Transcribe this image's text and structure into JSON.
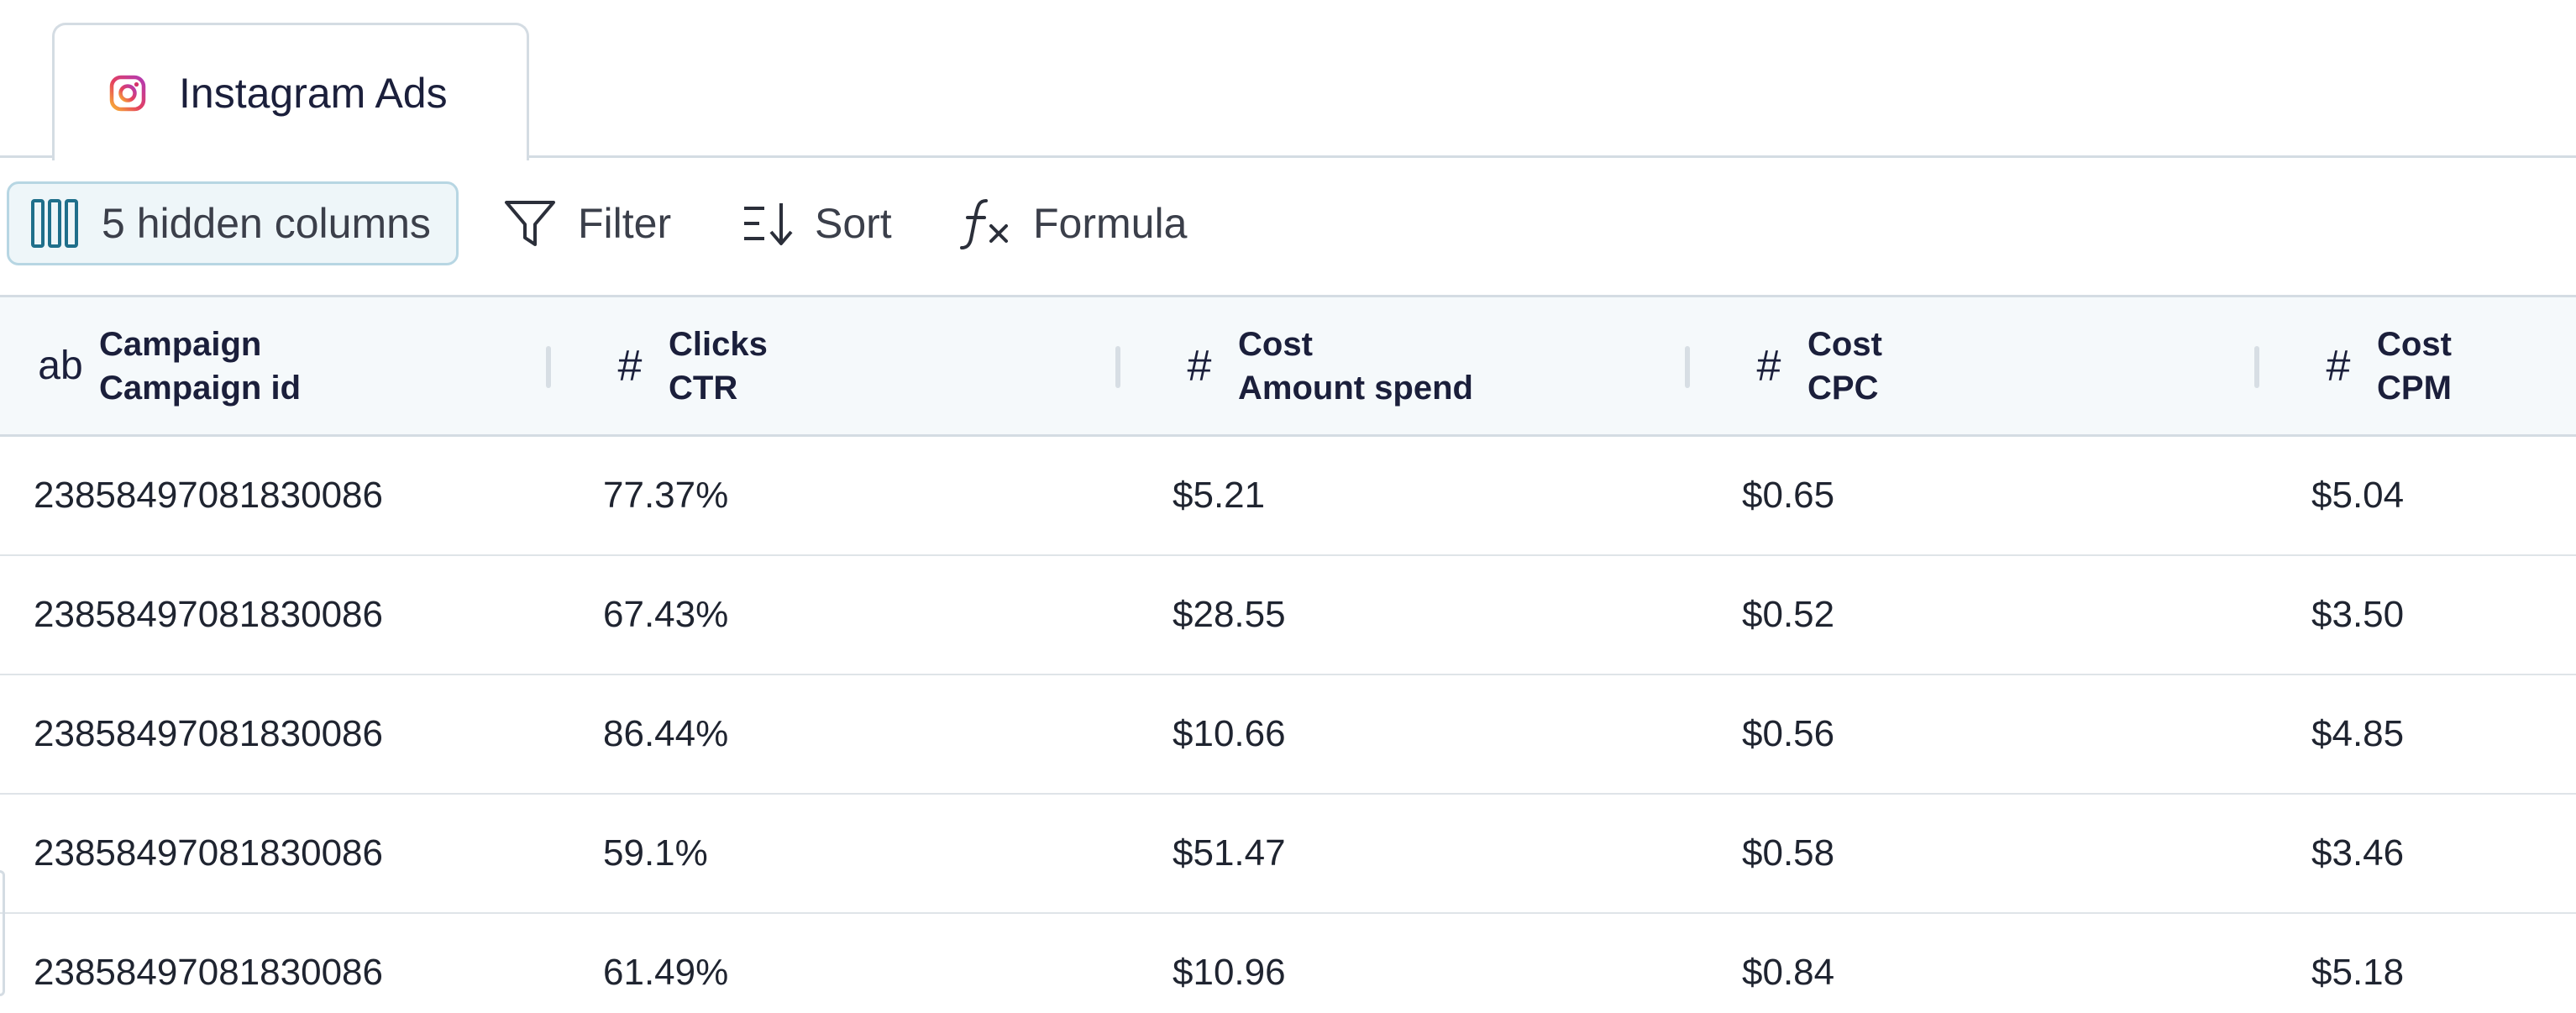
{
  "tab": {
    "icon": "instagram-icon",
    "label": "Instagram Ads"
  },
  "toolbar": {
    "hidden_columns": {
      "icon": "columns-icon",
      "label": "5 hidden columns"
    },
    "filter": {
      "icon": "filter-icon",
      "label": "Filter"
    },
    "sort": {
      "icon": "sort-icon",
      "label": "Sort"
    },
    "formula": {
      "icon": "formula-icon",
      "label": "Formula"
    }
  },
  "table": {
    "columns": [
      {
        "type": "ab",
        "line1": "Campaign",
        "line2": "Campaign id"
      },
      {
        "type": "#",
        "line1": "Clicks",
        "line2": "CTR"
      },
      {
        "type": "#",
        "line1": "Cost",
        "line2": "Amount spend"
      },
      {
        "type": "#",
        "line1": "Cost",
        "line2": "CPC"
      },
      {
        "type": "#",
        "line1": "Cost",
        "line2": "CPM"
      }
    ],
    "rows": [
      [
        "23858497081830086",
        "77.37%",
        "$5.21",
        "$0.65",
        "$5.04"
      ],
      [
        "23858497081830086",
        "67.43%",
        "$28.55",
        "$0.52",
        "$3.50"
      ],
      [
        "23858497081830086",
        "86.44%",
        "$10.66",
        "$0.56",
        "$4.85"
      ],
      [
        "23858497081830086",
        "59.1%",
        "$51.47",
        "$0.58",
        "$3.46"
      ],
      [
        "23858497081830086",
        "61.49%",
        "$10.96",
        "$0.84",
        "$5.18"
      ]
    ]
  },
  "colors": {
    "accent": "#1f6f8b",
    "border": "#d4dce3",
    "header_bg": "#f5f9fb"
  }
}
